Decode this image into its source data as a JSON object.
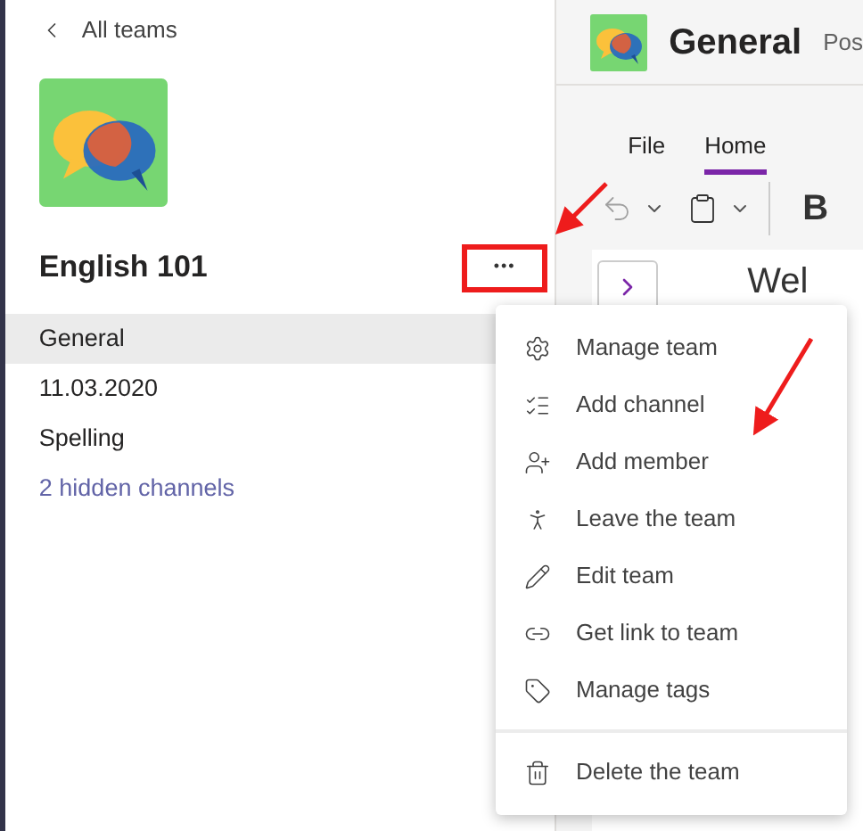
{
  "sidebar": {
    "back": "All teams",
    "team_name": "English 101",
    "more": "•••",
    "highlighted": true,
    "channels": [
      {
        "label": "General",
        "selected": true,
        "kind": "channel"
      },
      {
        "label": "11.03.2020",
        "selected": false,
        "kind": "channel"
      },
      {
        "label": "Spelling",
        "selected": false,
        "kind": "channel"
      },
      {
        "label": "2 hidden channels",
        "selected": false,
        "kind": "link"
      }
    ]
  },
  "channel_header": {
    "title": "General",
    "tab_fragment": "Pos"
  },
  "ribbon": {
    "tabs": [
      {
        "label": "File",
        "selected": false
      },
      {
        "label": "Home",
        "selected": true
      }
    ],
    "bold": "B"
  },
  "content": {
    "heading_fragment": "Wel"
  },
  "menu": {
    "groups": [
      {
        "items": [
          {
            "label": "Manage team"
          },
          {
            "label": "Add channel"
          },
          {
            "label": "Add member"
          },
          {
            "label": "Leave the team"
          },
          {
            "label": "Edit team"
          },
          {
            "label": "Get link to team"
          },
          {
            "label": "Manage tags"
          }
        ]
      },
      {
        "items": [
          {
            "label": "Delete the team"
          }
        ]
      }
    ]
  }
}
